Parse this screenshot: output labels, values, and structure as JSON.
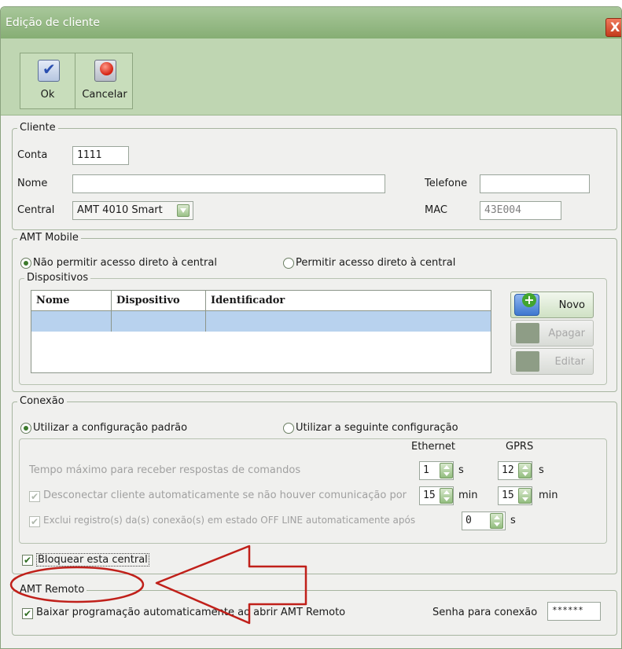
{
  "window": {
    "title": "Edição de cliente",
    "close_label": "X"
  },
  "toolbar": {
    "ok_label": "Ok",
    "cancel_label": "Cancelar"
  },
  "cliente": {
    "legend": "Cliente",
    "conta_label": "Conta",
    "conta_value": "1111",
    "nome_label": "Nome",
    "nome_value": "",
    "telefone_label": "Telefone",
    "telefone_value": "",
    "central_label": "Central",
    "central_value": "AMT 4010 Smart",
    "mac_label": "MAC",
    "mac_value": "43E004"
  },
  "amt_mobile": {
    "legend": "AMT Mobile",
    "radio_no_access": "Não permitir acesso direto à central",
    "radio_access": "Permitir acesso direto à central",
    "selected": "Não permitir acesso direto à central",
    "dispositivos_legend": "Dispositivos",
    "columns": [
      "Nome",
      "Dispositivo",
      "Identificador"
    ],
    "buttons": {
      "novo": "Novo",
      "apagar": "Apagar",
      "editar": "Editar"
    }
  },
  "conexao": {
    "legend": "Conexão",
    "radio_default": "Utilizar a configuração padrão",
    "radio_custom": "Utilizar a seguinte configuração",
    "selected": "Utilizar a configuração padrão",
    "col_ethernet": "Ethernet",
    "col_gprs": "GPRS",
    "tempo_label": "Tempo máximo para receber respostas de comandos",
    "tempo_eth": "1",
    "tempo_gprs": "12",
    "unit_s": "s",
    "desconectar_label": "Desconectar cliente automaticamente se não houver comunicação por",
    "desconectar_checked": true,
    "desc_eth": "15",
    "desc_gprs": "15",
    "unit_min": "min",
    "exclui_label": "Exclui registro(s) da(s) conexão(s) em estado OFF LINE automaticamente após",
    "exclui_checked": true,
    "exclui_value": "0",
    "bloquear_label": "Bloquear esta central",
    "bloquear_checked": true
  },
  "amt_remoto": {
    "legend": "AMT Remoto",
    "baixar_label": "Baixar programação automaticamente ao abrir AMT Remoto",
    "baixar_checked": true,
    "senha_label": "Senha para conexão",
    "senha_value": "******"
  },
  "colors": {
    "title_bar": "#86ae74",
    "toolbar": "#bfd6b2",
    "annotation": "#c0201a",
    "grid_selected_row": "#b8d2ee"
  }
}
